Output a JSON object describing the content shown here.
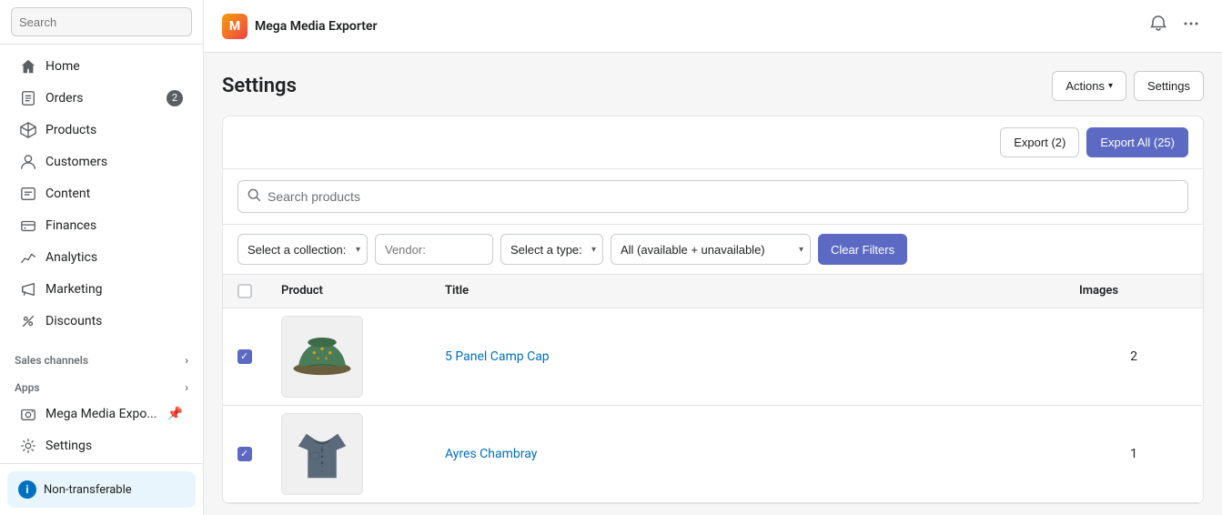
{
  "sidebar": {
    "search_placeholder": "Search",
    "items": [
      {
        "id": "home",
        "label": "Home",
        "icon": "🏠",
        "badge": null
      },
      {
        "id": "orders",
        "label": "Orders",
        "icon": "📋",
        "badge": "2"
      },
      {
        "id": "products",
        "label": "Products",
        "icon": "📦",
        "badge": null
      },
      {
        "id": "customers",
        "label": "Customers",
        "icon": "👤",
        "badge": null
      },
      {
        "id": "content",
        "label": "Content",
        "icon": "📄",
        "badge": null
      },
      {
        "id": "finances",
        "label": "Finances",
        "icon": "💰",
        "badge": null
      },
      {
        "id": "analytics",
        "label": "Analytics",
        "icon": "📊",
        "badge": null
      },
      {
        "id": "marketing",
        "label": "Marketing",
        "icon": "📢",
        "badge": null
      },
      {
        "id": "discounts",
        "label": "Discounts",
        "icon": "🏷️",
        "badge": null
      }
    ],
    "sections": [
      {
        "id": "sales-channels",
        "label": "Sales channels"
      },
      {
        "id": "apps",
        "label": "Apps"
      }
    ],
    "app_item": {
      "label": "Mega Media Expo...",
      "icon": "📷"
    },
    "settings_item": {
      "label": "Settings",
      "icon": "⚙️"
    },
    "footer": {
      "badge_label": "Non-transferable",
      "badge_icon": "i"
    }
  },
  "topbar": {
    "app_name": "Mega Media Exporter",
    "bell_icon": "🔔",
    "more_icon": "..."
  },
  "page": {
    "title": "Settings",
    "actions_btn": "Actions",
    "settings_btn": "Settings",
    "export_btn": "Export (2)",
    "export_all_btn": "Export All (25)",
    "search_placeholder": "Search products",
    "filters": {
      "collection_label": "Select a collection:",
      "vendor_label": "Vendor:",
      "type_label": "Select a type:",
      "availability_label": "All (available + unavailable)",
      "clear_btn": "Clear Filters"
    },
    "table": {
      "columns": [
        "Product",
        "Title",
        "Images"
      ],
      "rows": [
        {
          "id": "row1",
          "checked": true,
          "product_img_alt": "5 Panel Camp Cap",
          "title": "5 Panel Camp Cap",
          "images_count": "2"
        },
        {
          "id": "row2",
          "checked": true,
          "product_img_alt": "Ayres Chambray",
          "title": "Ayres Chambray",
          "images_count": "1"
        }
      ]
    }
  }
}
